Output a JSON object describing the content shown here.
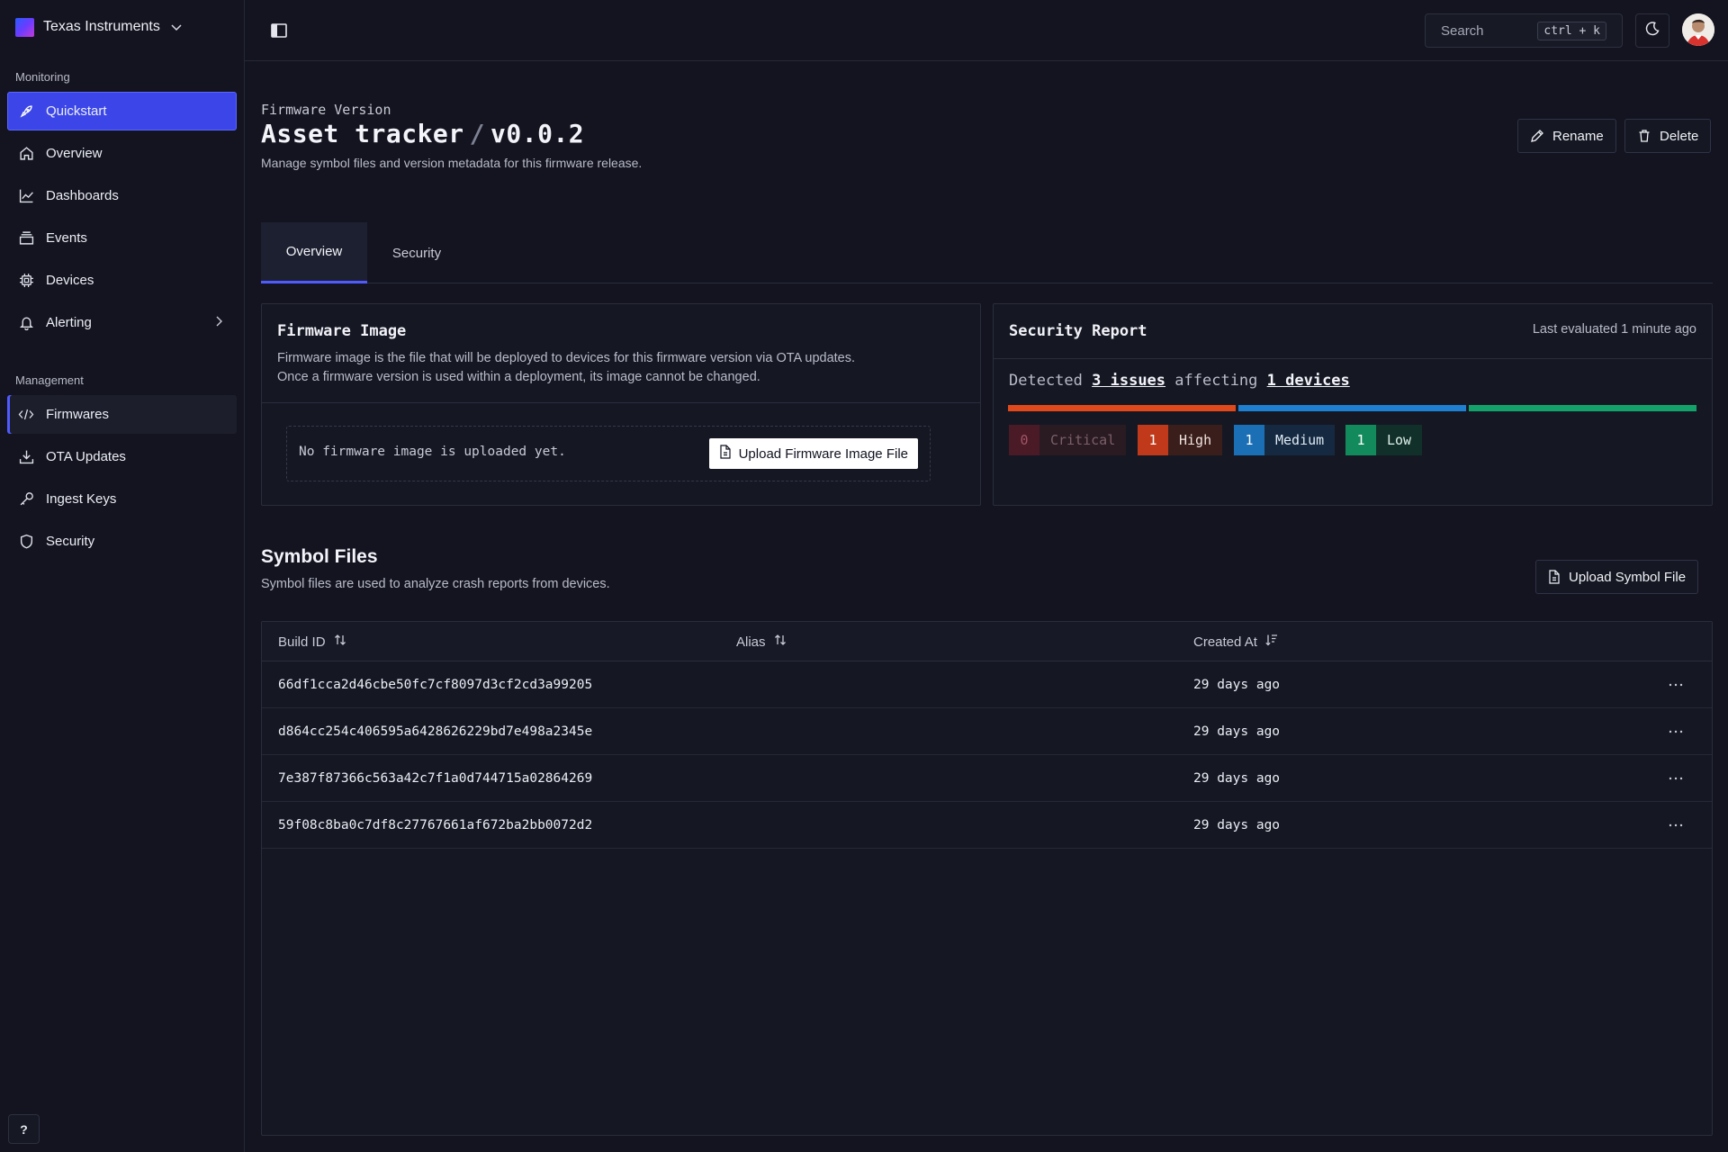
{
  "org": {
    "name": "Texas Instruments"
  },
  "sidebar": {
    "monitoring_label": "Monitoring",
    "management_label": "Management",
    "monitoring_items": [
      {
        "label": "Quickstart",
        "icon": "rocket-icon"
      },
      {
        "label": "Overview",
        "icon": "home-icon"
      },
      {
        "label": "Dashboards",
        "icon": "chart-icon"
      },
      {
        "label": "Events",
        "icon": "events-icon"
      },
      {
        "label": "Devices",
        "icon": "chip-icon"
      },
      {
        "label": "Alerting",
        "icon": "bell-icon"
      }
    ],
    "management_items": [
      {
        "label": "Firmwares",
        "icon": "code-icon"
      },
      {
        "label": "OTA Updates",
        "icon": "download-icon"
      },
      {
        "label": "Ingest Keys",
        "icon": "key-icon"
      },
      {
        "label": "Security",
        "icon": "shield-icon"
      }
    ],
    "help_label": "?"
  },
  "topbar": {
    "search_placeholder": "Search",
    "search_shortcut": "ctrl + k"
  },
  "header": {
    "eyebrow": "Firmware Version",
    "title_name": "Asset tracker",
    "title_sep": "/",
    "title_version": "v0.0.2",
    "description": "Manage symbol files and version metadata for this firmware release.",
    "rename_label": "Rename",
    "delete_label": "Delete"
  },
  "tabs": [
    {
      "label": "Overview",
      "active": true
    },
    {
      "label": "Security",
      "active": false
    }
  ],
  "firmware_image": {
    "title": "Firmware Image",
    "description_line1": "Firmware image is the file that will be deployed to devices for this firmware version via OTA updates.",
    "description_line2": "Once a firmware version is used within a deployment, its image cannot be changed.",
    "empty_text": "No firmware image is uploaded yet.",
    "upload_label": "Upload Firmware Image File"
  },
  "security_report": {
    "title": "Security Report",
    "last_evaluated": "Last evaluated 1 minute ago",
    "detected_prefix": "Detected",
    "issues_text": "3 issues",
    "affecting_text": "affecting",
    "devices_text": "1 devices",
    "severities": [
      {
        "count": "0",
        "label": "Critical",
        "color": "#5a1f2b"
      },
      {
        "count": "1",
        "label": "High",
        "color": "#e0491b"
      },
      {
        "count": "1",
        "label": "Medium",
        "color": "#1f7fd0"
      },
      {
        "count": "1",
        "label": "Low",
        "color": "#13a36a"
      }
    ]
  },
  "symbol_files": {
    "title": "Symbol Files",
    "description": "Symbol files are used to analyze crash reports from devices.",
    "upload_label": "Upload Symbol File",
    "columns": [
      "Build ID",
      "Alias",
      "Created At"
    ],
    "rows": [
      {
        "build_id": "66df1cca2d46cbe50fc7cf8097d3cf2cd3a99205",
        "alias": "",
        "created_at": "29 days ago"
      },
      {
        "build_id": "d864cc254c406595a6428626229bd7e498a2345e",
        "alias": "",
        "created_at": "29 days ago"
      },
      {
        "build_id": "7e387f87366c563a42c7f1a0d744715a02864269",
        "alias": "",
        "created_at": "29 days ago"
      },
      {
        "build_id": "59f08c8ba0c7df8c27767661af672ba2bb0072d2",
        "alias": "",
        "created_at": "29 days ago"
      }
    ]
  }
}
